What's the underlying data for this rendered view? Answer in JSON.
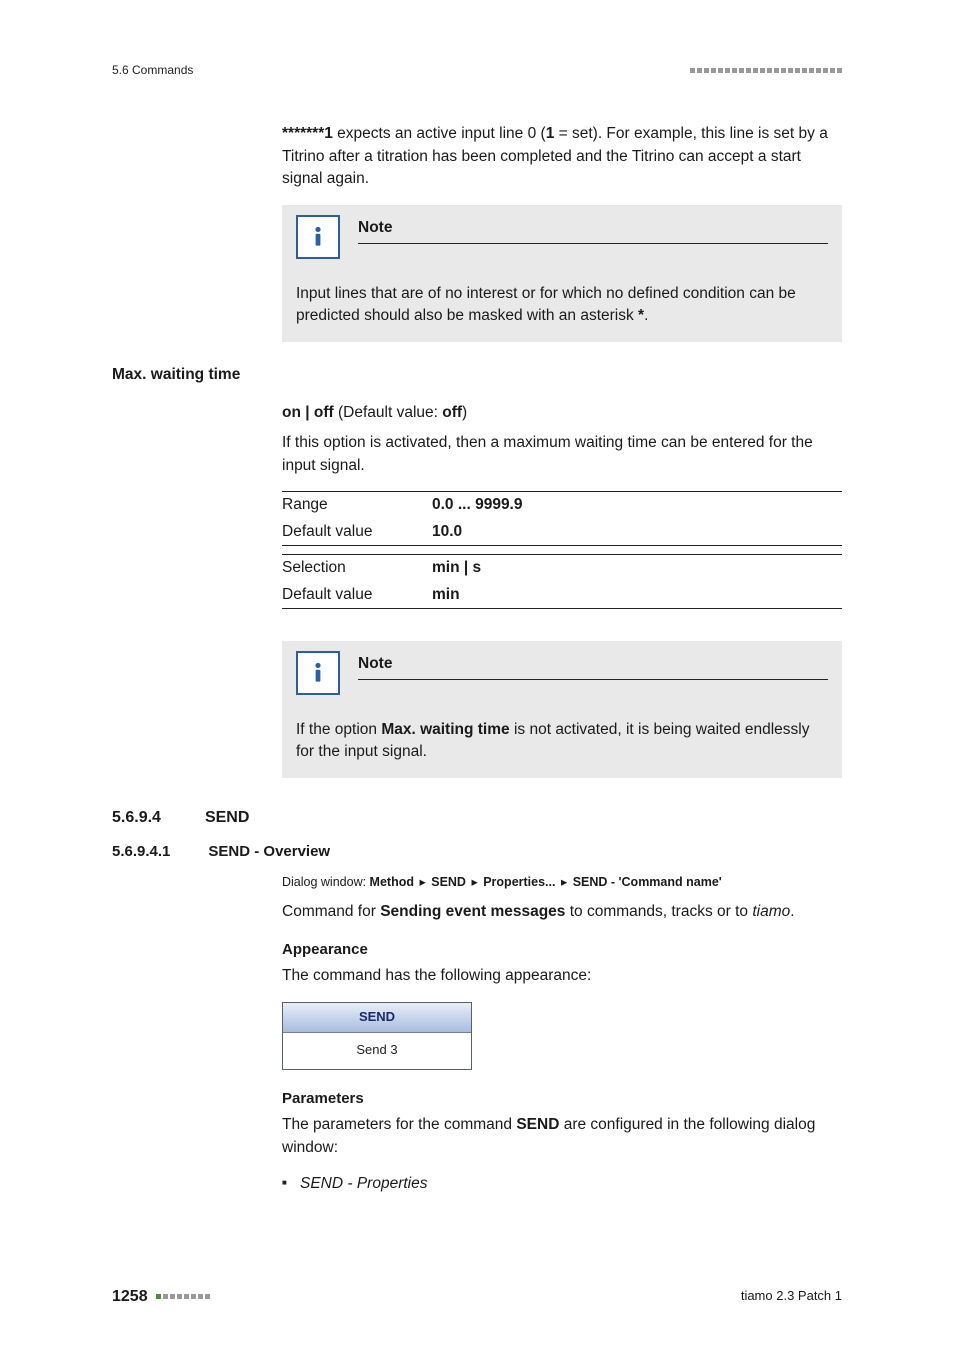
{
  "header": {
    "section": "5.6 Commands"
  },
  "intro": {
    "pattern": "*******1",
    "text1": " expects an active input line 0 (",
    "one": "1",
    "text2": " = set). For example, this line is set by a Titrino after a titration has been completed and the Titrino can accept a start signal again."
  },
  "note1": {
    "title": "Note",
    "body_a": "Input lines that are of no interest or for which no defined condition can be predicted should also be masked with an asterisk ",
    "star": "*",
    "body_b": "."
  },
  "maxwait": {
    "label": "Max. waiting time",
    "onoff_a": "on | off",
    "onoff_b": " (Default value: ",
    "onoff_c": "off",
    "onoff_d": ")",
    "desc": "If this option is activated, then a maximum waiting time can be entered for the input signal.",
    "table": {
      "range_label": "Range",
      "range_value": "0.0 ... 9999.9",
      "default1_label": "Default value",
      "default1_value": "10.0",
      "selection_label": "Selection",
      "selection_value": "min | s",
      "default2_label": "Default value",
      "default2_value": "min"
    }
  },
  "note2": {
    "title": "Note",
    "body_a": "If the option ",
    "body_bold": "Max. waiting time",
    "body_b": " is not activated, it is being waited endlessly for the input signal."
  },
  "send": {
    "num1": "5.6.9.4",
    "title1": "SEND",
    "num2": "5.6.9.4.1",
    "title2": "SEND - Overview",
    "dialog": {
      "prefix": "Dialog window: ",
      "p1": "Method",
      "p2": "SEND",
      "p3": "Properties...",
      "p4": "SEND - 'Command name'",
      "sep": "▸"
    },
    "cmd_a": "Command for ",
    "cmd_bold": "Sending event messages",
    "cmd_b": " to commands, tracks or to ",
    "cmd_italic": "tiamo",
    "cmd_c": ".",
    "appearance_head": "Appearance",
    "appearance_text": "The command has the following appearance:",
    "widget": {
      "title": "SEND",
      "body": "Send 3"
    },
    "params_head": "Parameters",
    "params_text_a": "The parameters for the command ",
    "params_bold": "SEND",
    "params_text_b": " are configured in the following dialog window:",
    "bullet": "SEND - Properties"
  },
  "footer": {
    "page": "1258",
    "right": "tiamo 2.3 Patch 1"
  }
}
